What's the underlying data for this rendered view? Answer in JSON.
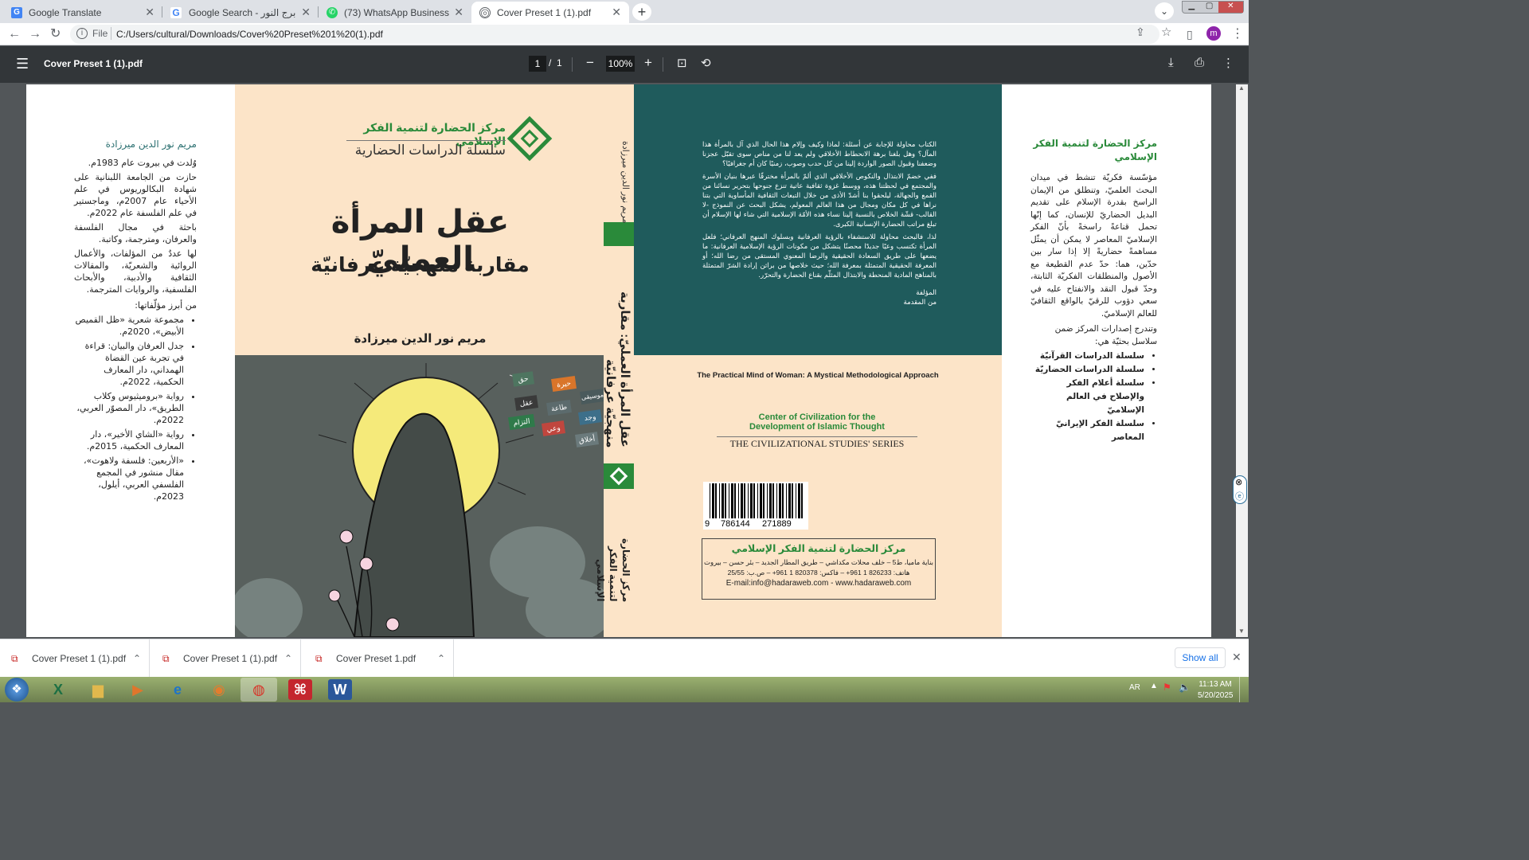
{
  "tabs": [
    {
      "label": "Google Translate",
      "icon": "translate-icon"
    },
    {
      "label": "Google Search - برج النور",
      "icon": "google-icon"
    },
    {
      "label": "(73) WhatsApp Business",
      "icon": "whatsapp-icon"
    },
    {
      "label": "Cover Preset 1 (1).pdf",
      "icon": "globe-icon",
      "active": true
    }
  ],
  "addressbar": {
    "scheme": "File",
    "url": "C:/Users/cultural/Downloads/Cover%20Preset%201%20(1).pdf",
    "avatar": "m"
  },
  "pdf": {
    "title": "Cover Preset 1 (1).pdf",
    "page": "1",
    "separator": "/",
    "total": "1",
    "zoom": "100%"
  },
  "backflap": {
    "author": "مريم نور الدين ميرزادة",
    "p1": "وُلدت في بيروت عام 1983م.",
    "p2": "حازت من الجامعة اللبنانية على شهادة البكالوريوس في علم الأحياء عام 2007م، وماجستير في علم الفلسفة عام 2022م.",
    "p3": "باحثة في مجال الفلسفة والعرفان، ومترجمة، وكاتبة.",
    "p4": "لها عددٌ من المؤلفات، والأعمال الروائية والشعريّة، والمقالات الثقافية والأدبية، والأبحاث الفلسفية، والروايات المترجمة.",
    "works_heading": "من أبرز مؤلّفاتها:",
    "works": [
      "مجموعة شعرية «ظل القميص الأبيض»، 2020م.",
      "جدل العرفان والبيان: قراءة في تجربة عين القضاة الهمداني، دار المعارف الحكمية، 2022م.",
      "رواية «بروميثيوس وكلاب الطريق»، دار المصوّر العربي، 2022م.",
      "رواية «الشاي الأخير»، دار المعارف الحكمية، 2015م.",
      "«الأربعين: فلسفة ولاهوت»، مقال منشور في المجمع الفلسفي العربي، أيلول، 2023م."
    ]
  },
  "front": {
    "publisher": "مركز الحضارة لتنمية الفكر الإسلامي",
    "series": "سلسلة الدراسات الحضارية",
    "title": "عقل المرأة العمليّ",
    "subtitle": "مقاربة منهجيّة عرفانيّة",
    "author": "مريم نور الدين ميرزادة",
    "tags": [
      "حيرة",
      "حق",
      "موسيقى",
      "عقل",
      "طاعة",
      "وجد",
      "التزام",
      "وعي",
      "أخلاق"
    ]
  },
  "spine": {
    "author": "مريم نور الدين ميرزادة",
    "title": "عقل المرأة العمليّ: مقاربة منهجيّة عرفانيّة",
    "publisher": "مركز الحضارة لتنمية الفكر الإسلامي"
  },
  "back": {
    "p1": "الكتاب محاولة للإجابة عن أسئلة: لماذا وكيف وإلام هذا الحال الذي آل بالمرأة هذا المآل؟ وهل بلغنا برهة الانحطاط الأخلاقي ولم يعد لنا من مناص سوى تقبّل عجزنا وضعفنا وقبول الصور الواردة إلينا من كل حدب وصوب، زمنيًا كان أم جغرافيًا؟",
    "p2": "ففي خضمّ الابتذال والنكوص الأخلاقي الذي ألمّ بالمرأة مخترقًا عبرها بنيان الأسرة والمجتمع في لحظتنا هذه، ووسط غزوة ثقافية عاتية تنزع جنوحها بتحرير نسائنا من القمع والجهالة، ليلحقوا بنا أشدّ الأذى من خلال التبعات الثقافية المأساوية التي بتنا نراها في كل مكان ومجال من هذا العالم المعولم، يشكل البحث عن النموذج -لا القالب- قشّة الخلاص بالنسبة إلينا نساء هذه الأمّة الإسلامية التي شاء لها الإسلام أن تبلغ مراتب الحضارة الإنسانية الكبرى.",
    "p3": "لذا، فالبحث محاولة للاستشفاء بالرؤية العرفانية وبسلوك المنهج العرفاني؛ فلعل المرأة تكتسب وعيًا جديدًا محصنًا يتشكل من مكونات الرؤية الإسلامية العرفانية: ما يضعها على طريق السعادة الحقيقية والرضا المعنوي المستقى من رضا الله؛ أو المعرفة الحقيقية المتمثلة بمعرفة الله؛ حيث خلاصها من براثن إرادة الشرّ المتمثلة بالمناهج المادية المنحطة والابتذال المثلّم بقناع الحضارة والتحرّر.",
    "sig1": "المؤلفة",
    "sig2": "من المقدمة",
    "en_title": "The Practical Mind of Woman: A Mystical Methodological Approach",
    "center_en": "Center of Civilization for the Development of Islamic Thought",
    "series_en": "THE CIVILIZATIONAL STUDIES' SERIES",
    "barcode_left": "9",
    "barcode_mid": "786144",
    "barcode_right": "271889",
    "box_title": "مركز الحضارة لتنمية الفكر الإسلامي",
    "box_addr": "بناية ماميا، ط5 – خلف محلات مكداشي – طريق المطار الجديد – بئر حسن – بيروت",
    "box_phone": "هاتف: 826233 1 961+ – فاكس: 820378 1 961+ – ص.ب: 25/55",
    "box_web": "E-mail:info@hadaraweb.com - www.hadaraweb.com"
  },
  "frontflap": {
    "title": "مركز الحضارة لتنمية الفكر الإسلامي",
    "p1": "مؤسّسة فكريّة تنشط في ميدان البحث العلميّ، وتنطلق من الإيمان الراسخ بقدرة الإسلام على تقديم البديل الحضاريّ للإنسان، كما إنّها تحمل قناعةً راسخةً بأنّ الفكر الإسلاميّ المعاصر لا يمكن أن يمثّل مساهمةً حضاريةً إلا إذا سار بين حدّين، هما: حدّ عدم القطيعة مع الأصول والمنطلقات الفكريّة الثابتة، وحدّ قبول النقد والانفتاح عليه في سعي دؤوب للرقيّ بالواقع الثقافيّ للعالم الإسلاميّ.",
    "p2": "وتندرج إصدارات المركز ضمن سلاسل بحثيّة هي:",
    "series": [
      "سلسلة الدراسات القرآنيّة",
      "سلسلة الدراسات الحضاريّة",
      "سلسلة أعلام الفكر والإصلاح في العالم الإسلاميّ",
      "سلسلة الفكر الإيرانيّ المعاصر"
    ]
  },
  "downloads": {
    "items": [
      "Cover Preset 1 (1).pdf",
      "Cover Preset 1 (1).pdf",
      "Cover Preset 1.pdf"
    ],
    "show_all": "Show all"
  },
  "taskbar": {
    "lang": "AR",
    "time": "11:13 AM",
    "date": "5/20/2025"
  },
  "colors": {
    "cover": "#fce4c8",
    "teal": "#1f5b5c",
    "green": "#2a8a3a",
    "pdfbar": "#323639"
  }
}
